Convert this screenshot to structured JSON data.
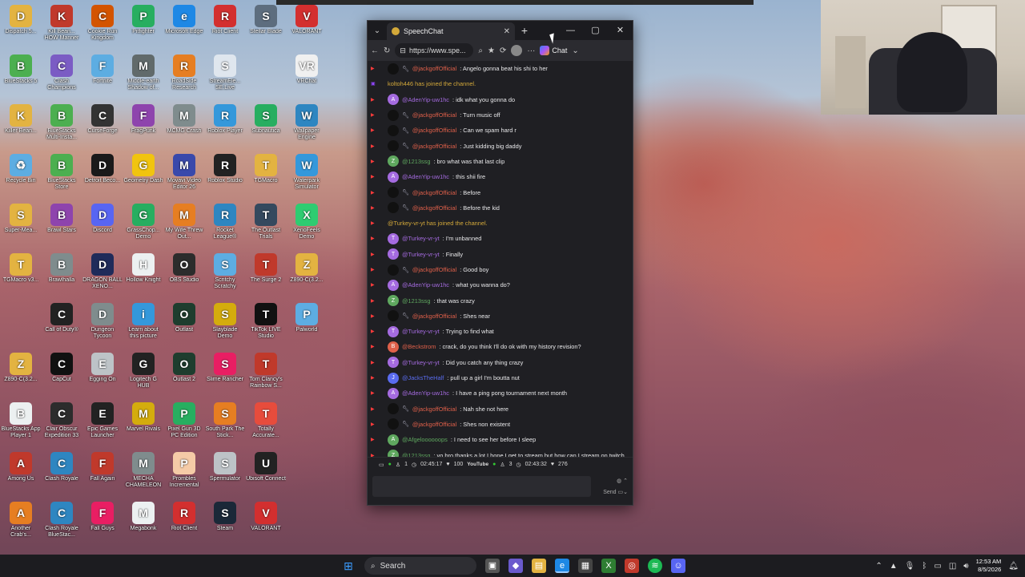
{
  "desktop_icons": [
    {
      "label": "Dispatch 5...",
      "icon": "D",
      "color": "#e3b341",
      "col": 0,
      "row": 0
    },
    {
      "label": "Kill Bean... HOW Manner",
      "icon": "K",
      "color": "#c0392b",
      "col": 1,
      "row": 0
    },
    {
      "label": "Cookie Run Kingdom",
      "icon": "C",
      "color": "#d35400",
      "col": 2,
      "row": 0
    },
    {
      "label": "Pitfighter",
      "icon": "P",
      "color": "#27ae60",
      "col": 3,
      "row": 0
    },
    {
      "label": "Microsoft Edge",
      "icon": "e",
      "color": "#1e88e5",
      "col": 4,
      "row": 0
    },
    {
      "label": "Riot Client",
      "icon": "R",
      "color": "#d32f2f",
      "col": 5,
      "row": 0
    },
    {
      "label": "Stellar Blade",
      "icon": "S",
      "color": "#5d6d7e",
      "col": 6,
      "row": 0
    },
    {
      "label": "VALORANT",
      "icon": "V",
      "color": "#d32f2f",
      "col": 7,
      "row": 0
    },
    {
      "label": "BlueStacks 5",
      "icon": "B",
      "color": "#4caf50",
      "col": 0,
      "row": 1
    },
    {
      "label": "Clash Champions",
      "icon": "C",
      "color": "#7b5cc4",
      "col": 1,
      "row": 1
    },
    {
      "label": "Fortnite",
      "icon": "F",
      "color": "#5dade2",
      "col": 2,
      "row": 1
    },
    {
      "label": "Middle-earth Shadow of...",
      "icon": "M",
      "color": "#616a6b",
      "col": 3,
      "row": 1
    },
    {
      "label": "RoadSide Research",
      "icon": "R",
      "color": "#e67e22",
      "col": 4,
      "row": 1
    },
    {
      "label": "StreamEle... SE.Live",
      "icon": "S",
      "color": "#dfe6ee",
      "col": 5,
      "row": 1
    },
    {
      "label": "VRChat",
      "icon": "VR",
      "color": "#f0f0f0",
      "col": 7,
      "row": 1
    },
    {
      "label": "Killer Bean...",
      "icon": "K",
      "color": "#e3b341",
      "col": 0,
      "row": 2
    },
    {
      "label": "BlueStacks Multi-Insta...",
      "icon": "B",
      "color": "#4caf50",
      "col": 1,
      "row": 2
    },
    {
      "label": "CurseForge",
      "icon": "C",
      "color": "#333333",
      "col": 2,
      "row": 2
    },
    {
      "label": "FragPunk",
      "icon": "F",
      "color": "#8e44ad",
      "col": 3,
      "row": 2
    },
    {
      "label": "MCMG Crash",
      "icon": "M",
      "color": "#7f8c8d",
      "col": 4,
      "row": 2
    },
    {
      "label": "Roblox Player",
      "icon": "R",
      "color": "#3498db",
      "col": 5,
      "row": 2
    },
    {
      "label": "Subnautica",
      "icon": "S",
      "color": "#27ae60",
      "col": 6,
      "row": 2
    },
    {
      "label": "Wallpaper Engine",
      "icon": "W",
      "color": "#2e86c1",
      "col": 7,
      "row": 2
    },
    {
      "label": "Recycle Bin",
      "icon": "♻",
      "color": "#5dade2",
      "col": 0,
      "row": 3
    },
    {
      "label": "BlueStacks Store",
      "icon": "B",
      "color": "#4caf50",
      "col": 1,
      "row": 3
    },
    {
      "label": "Detroit Beco...",
      "icon": "D",
      "color": "#1a1a1a",
      "col": 2,
      "row": 3
    },
    {
      "label": "Geometry Dash",
      "icon": "G",
      "color": "#f1c40f",
      "col": 3,
      "row": 3
    },
    {
      "label": "Movavi Video Editor 26",
      "icon": "M",
      "color": "#3949ab",
      "col": 4,
      "row": 3
    },
    {
      "label": "Roblox Studio",
      "icon": "R",
      "color": "#222222",
      "col": 5,
      "row": 3
    },
    {
      "label": "TGMacro",
      "icon": "T",
      "color": "#e3b341",
      "col": 6,
      "row": 3
    },
    {
      "label": "Waterpark Simulator",
      "icon": "W",
      "color": "#3498db",
      "col": 7,
      "row": 3
    },
    {
      "label": "Super-Mea...",
      "icon": "S",
      "color": "#e3b341",
      "col": 0,
      "row": 4
    },
    {
      "label": "Brawl Stars",
      "icon": "B",
      "color": "#8e44ad",
      "col": 1,
      "row": 4
    },
    {
      "label": "Discord",
      "icon": "D",
      "color": "#5865f2",
      "col": 2,
      "row": 4
    },
    {
      "label": "GrassChop... Demo",
      "icon": "G",
      "color": "#27ae60",
      "col": 3,
      "row": 4
    },
    {
      "label": "My Wife Threw Out...",
      "icon": "M",
      "color": "#e67e22",
      "col": 4,
      "row": 4
    },
    {
      "label": "Rocket League®",
      "icon": "R",
      "color": "#2e86c1",
      "col": 5,
      "row": 4
    },
    {
      "label": "The Outlast Trials",
      "icon": "T",
      "color": "#34495e",
      "col": 6,
      "row": 4
    },
    {
      "label": "XenoFeels Demo",
      "icon": "X",
      "color": "#2ecc71",
      "col": 7,
      "row": 4
    },
    {
      "label": "TGMacro v3...",
      "icon": "T",
      "color": "#e3b341",
      "col": 0,
      "row": 5
    },
    {
      "label": "Brawlhalla",
      "icon": "B",
      "color": "#7f8c8d",
      "col": 1,
      "row": 5
    },
    {
      "label": "DRAGON BALL XENO...",
      "icon": "D",
      "color": "#1f2b5a",
      "col": 2,
      "row": 5
    },
    {
      "label": "Hollow Knight",
      "icon": "H",
      "color": "#ecf0f1",
      "col": 3,
      "row": 5
    },
    {
      "label": "OBS Studio",
      "icon": "O",
      "color": "#2c2c2c",
      "col": 4,
      "row": 5
    },
    {
      "label": "Scritchy Scratchy",
      "icon": "S",
      "color": "#5dade2",
      "col": 5,
      "row": 5
    },
    {
      "label": "The Surge 2",
      "icon": "T",
      "color": "#c0392b",
      "col": 6,
      "row": 5
    },
    {
      "label": "Z890-C(3.2...",
      "icon": "Z",
      "color": "#e3b341",
      "col": 7,
      "row": 5
    },
    {
      "label": "Call of Duty®",
      "icon": "C",
      "color": "#222222",
      "col": 1,
      "row": 6
    },
    {
      "label": "Dungeon Tycoon",
      "icon": "D",
      "color": "#7f8c8d",
      "col": 2,
      "row": 6
    },
    {
      "label": "Learn about this picture",
      "icon": "i",
      "color": "#3498db",
      "col": 3,
      "row": 6
    },
    {
      "label": "Outlast",
      "icon": "O",
      "color": "#1e3d2e",
      "col": 4,
      "row": 6
    },
    {
      "label": "Slayblade Demo",
      "icon": "S",
      "color": "#d4ac0d",
      "col": 5,
      "row": 6
    },
    {
      "label": "TikTok LIVE Studio",
      "icon": "T",
      "color": "#111111",
      "col": 6,
      "row": 6
    },
    {
      "label": "Palworld",
      "icon": "P",
      "color": "#5dade2",
      "col": 7,
      "row": 6
    },
    {
      "label": "Z890-C(3.2...",
      "icon": "Z",
      "color": "#e3b341",
      "col": 0,
      "row": 7
    },
    {
      "label": "CapCut",
      "icon": "C",
      "color": "#111111",
      "col": 1,
      "row": 7
    },
    {
      "label": "Egging On",
      "icon": "E",
      "color": "#bdc3c7",
      "col": 2,
      "row": 7
    },
    {
      "label": "Logitech G HUB",
      "icon": "G",
      "color": "#222222",
      "col": 3,
      "row": 7
    },
    {
      "label": "Outlast 2",
      "icon": "O",
      "color": "#1e3d2e",
      "col": 4,
      "row": 7
    },
    {
      "label": "Slime Rancher",
      "icon": "S",
      "color": "#e91e63",
      "col": 5,
      "row": 7
    },
    {
      "label": "Tom Clancy's Rainbow S...",
      "icon": "T",
      "color": "#c0392b",
      "col": 6,
      "row": 7
    },
    {
      "label": "BlueStacks App Player 1",
      "icon": "B",
      "color": "#ecf0f1",
      "col": 0,
      "row": 8
    },
    {
      "label": "Clair Obscur Expedition 33",
      "icon": "C",
      "color": "#2c2c2c",
      "col": 1,
      "row": 8
    },
    {
      "label": "Epic Games Launcher",
      "icon": "E",
      "color": "#222222",
      "col": 2,
      "row": 8
    },
    {
      "label": "Marvel Rivals",
      "icon": "M",
      "color": "#d4ac0d",
      "col": 3,
      "row": 8
    },
    {
      "label": "Pixel Gun 3D PC Edition",
      "icon": "P",
      "color": "#27ae60",
      "col": 4,
      "row": 8
    },
    {
      "label": "South Park The Stick...",
      "icon": "S",
      "color": "#e67e22",
      "col": 5,
      "row": 8
    },
    {
      "label": "Totally Accurate...",
      "icon": "T",
      "color": "#e74c3c",
      "col": 6,
      "row": 8
    },
    {
      "label": "Among Us",
      "icon": "A",
      "color": "#c0392b",
      "col": 0,
      "row": 9
    },
    {
      "label": "Clash Royale",
      "icon": "C",
      "color": "#2e86c1",
      "col": 1,
      "row": 9
    },
    {
      "label": "Fall Again",
      "icon": "F",
      "color": "#c0392b",
      "col": 2,
      "row": 9
    },
    {
      "label": "MECHA CHAMELEON",
      "icon": "M",
      "color": "#7f8c8d",
      "col": 3,
      "row": 9
    },
    {
      "label": "Prombles Incremental",
      "icon": "P",
      "color": "#f5cba7",
      "col": 4,
      "row": 9
    },
    {
      "label": "Spermulator",
      "icon": "S",
      "color": "#bdc3c7",
      "col": 5,
      "row": 9
    },
    {
      "label": "Ubisoft Connect",
      "icon": "U",
      "color": "#222222",
      "col": 6,
      "row": 9
    },
    {
      "label": "Another Crab's...",
      "icon": "A",
      "color": "#e67e22",
      "col": 0,
      "row": 10
    },
    {
      "label": "Clash Royale BlueStac...",
      "icon": "C",
      "color": "#2e86c1",
      "col": 1,
      "row": 10
    },
    {
      "label": "Fall Guys",
      "icon": "F",
      "color": "#e91e63",
      "col": 2,
      "row": 10
    },
    {
      "label": "Megabonk",
      "icon": "M",
      "color": "#ecf0f1",
      "col": 3,
      "row": 10
    },
    {
      "label": "Riot Client",
      "icon": "R",
      "color": "#d32f2f",
      "col": 4,
      "row": 10
    },
    {
      "label": "Steam",
      "icon": "S",
      "color": "#1b2838",
      "col": 5,
      "row": 10
    },
    {
      "label": "VALORANT",
      "icon": "V",
      "color": "#d32f2f",
      "col": 6,
      "row": 10
    }
  ],
  "browser": {
    "tab_title": "SpeechChat",
    "url": "https://www.spe...",
    "chat_label": "Chat",
    "tab_close": "✕",
    "new_tab": "+",
    "minimize": "—",
    "maximize": "▢",
    "close": "✕"
  },
  "chat": [
    {
      "platform": "YouTube",
      "name": "@jackgoffOfficial",
      "color": "#e0604a",
      "msg": ": Angelo gonna beat his shi to her",
      "badge": true
    },
    {
      "platform": "Twitch",
      "name": "",
      "color": "#d4a93a",
      "msg": "koltoh446 has joined the channel.",
      "sys": true
    },
    {
      "platform": "YouTube",
      "name": "@AdenYip-uw1hc",
      "color": "#a56be0",
      "msg": ": idk what you gonna do",
      "av": "A"
    },
    {
      "platform": "YouTube",
      "name": "@jackgoffOfficial",
      "color": "#e0604a",
      "msg": ": Turn music off",
      "badge": true
    },
    {
      "platform": "YouTube",
      "name": "@jackgoffOfficial",
      "color": "#e0604a",
      "msg": ": Can we spam hard r",
      "badge": true
    },
    {
      "platform": "YouTube",
      "name": "@jackgoffOfficial",
      "color": "#e0604a",
      "msg": ": Just kidding big daddy",
      "badge": true
    },
    {
      "platform": "YouTube",
      "name": "@1213ssg",
      "color": "#5fa85f",
      "msg": ": bro what was that last clip",
      "av": "Z"
    },
    {
      "platform": "YouTube",
      "name": "@AdenYip-uw1hc",
      "color": "#a56be0",
      "msg": ": this shii fire",
      "av": "A"
    },
    {
      "platform": "YouTube",
      "name": "@jackgoffOfficial",
      "color": "#e0604a",
      "msg": ": Before",
      "badge": true
    },
    {
      "platform": "YouTube",
      "name": "@jackgoffOfficial",
      "color": "#e0604a",
      "msg": ": Before the kid",
      "badge": true
    },
    {
      "platform": "YouTube",
      "name": "",
      "color": "#d4a93a",
      "msg": "@Turkey-vr-yt has joined the channel.",
      "sys": true
    },
    {
      "platform": "YouTube",
      "name": "@Turkey-vr-yt",
      "color": "#a56be0",
      "msg": ": I'm unbanned",
      "av": "T"
    },
    {
      "platform": "YouTube",
      "name": "@Turkey-vr-yt",
      "color": "#a56be0",
      "msg": ": Finally",
      "av": "T"
    },
    {
      "platform": "YouTube",
      "name": "@jackgoffOfficial",
      "color": "#e0604a",
      "msg": ": Good boy",
      "badge": true
    },
    {
      "platform": "YouTube",
      "name": "@AdenYip-uw1hc",
      "color": "#a56be0",
      "msg": ": what you wanna do?",
      "av": "A"
    },
    {
      "platform": "YouTube",
      "name": "@1213ssg",
      "color": "#5fa85f",
      "msg": ": that was crazy",
      "av": "Z"
    },
    {
      "platform": "YouTube",
      "name": "@jackgoffOfficial",
      "color": "#e0604a",
      "msg": ": Shes near",
      "badge": true
    },
    {
      "platform": "YouTube",
      "name": "@Turkey-vr-yt",
      "color": "#a56be0",
      "msg": ": Trying to find what",
      "av": "T"
    },
    {
      "platform": "YouTube",
      "name": "@Beckstrom",
      "color": "#e0604a",
      "msg": ": crack, do you think I'll do ok with my history revision?",
      "av": "B"
    },
    {
      "platform": "YouTube",
      "name": "@Turkey-vr-yt",
      "color": "#a56be0",
      "msg": ": Did you catch any thing crazy",
      "av": "T"
    },
    {
      "platform": "YouTube",
      "name": "@JacksTheHalf",
      "color": "#5a6cf0",
      "msg": ": pull up a girl I'm boutta nut",
      "av": "J"
    },
    {
      "platform": "YouTube",
      "name": "@AdenYip-uw1hc",
      "color": "#a56be0",
      "msg": ": I have a ping pong tournament next month",
      "av": "A"
    },
    {
      "platform": "YouTube",
      "name": "@jackgoffOfficial",
      "color": "#e0604a",
      "msg": ": Nah she not here",
      "badge": true
    },
    {
      "platform": "YouTube",
      "name": "@jackgoffOfficial",
      "color": "#e0604a",
      "msg": ": Shes non existent",
      "badge": true
    },
    {
      "platform": "YouTube",
      "name": "@Afgeloooooops",
      "color": "#5fa85f",
      "msg": ": I need to see her before I sleep",
      "av": "A"
    },
    {
      "platform": "YouTube",
      "name": "@1213ssg",
      "color": "#5fa85f",
      "msg": ": yo bro thanks a lot I hope I get to stream but how can I stream on twitch",
      "av": "Z"
    }
  ],
  "stats": {
    "twitch_viewers": "1",
    "twitch_time": "02:45:17",
    "twitch_likes": "100",
    "yt_label": "YouTube",
    "yt_viewers": "3",
    "yt_time": "02:43:32",
    "yt_likes": "276"
  },
  "input": {
    "send": "Send"
  },
  "taskbar": {
    "search": "Search",
    "time": "12:53 AM",
    "date": "8/5/2026"
  },
  "colors": {
    "accent": "#d4a93a",
    "window_bg": "#1f1f23",
    "taskbar_bg": "#1c1c20"
  }
}
